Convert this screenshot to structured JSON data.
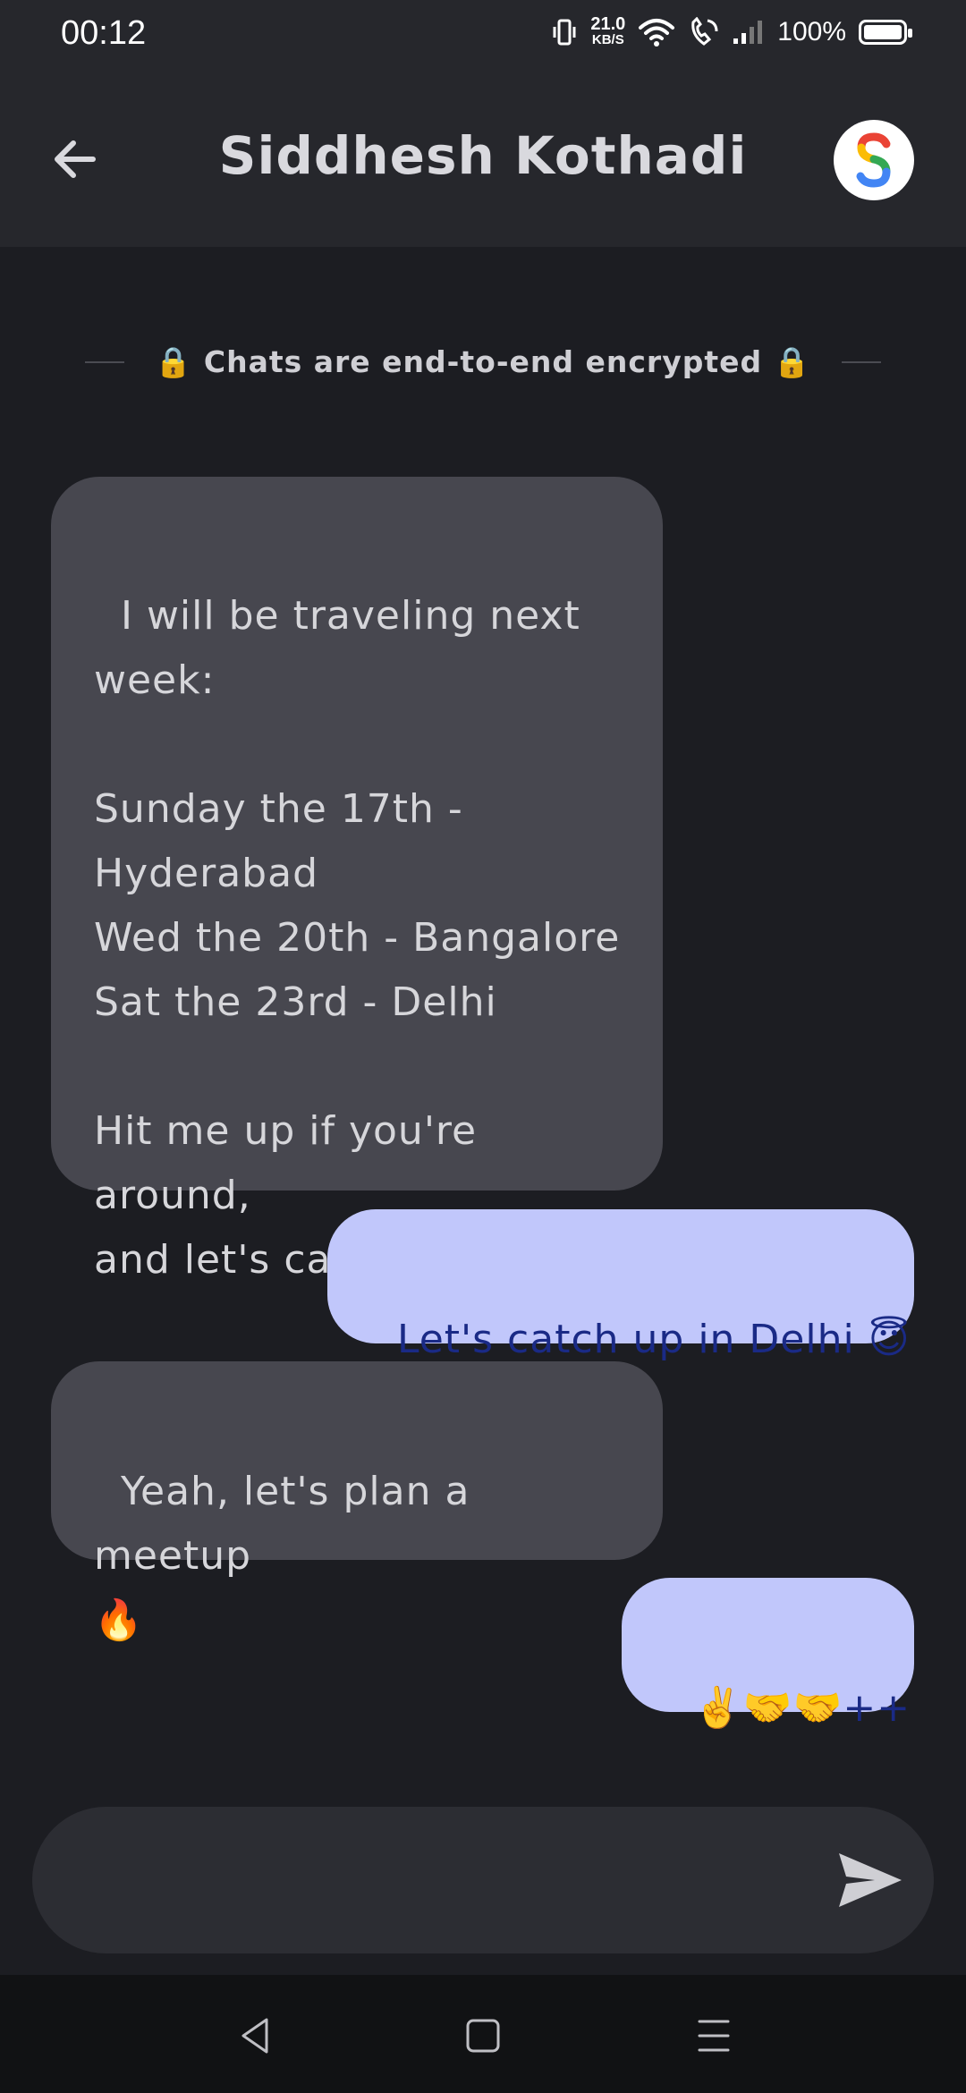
{
  "status_bar": {
    "time": "00:12",
    "net_speed_value": "21.0",
    "net_speed_unit": "KB/S",
    "battery": "100%"
  },
  "header": {
    "title": "Siddhesh Kothadi",
    "avatar_letter": "S"
  },
  "encryption_notice": "🔒 Chats are end-to-end encrypted 🔒",
  "messages": [
    {
      "from": "them",
      "text": "I will be traveling next\nweek:\n\nSunday the 17th -\nHyderabad\nWed the 20th - Bangalore\nSat the 23rd - Delhi\n\nHit me up if you're around,\nand let's catch up! 🚀"
    },
    {
      "from": "me",
      "text": "Let's catch up in Delhi 😇"
    },
    {
      "from": "them",
      "text": "Yeah, let's plan a meetup\n🔥"
    },
    {
      "from": "me",
      "text": "✌️🤝🤝++"
    }
  ],
  "composer": {
    "value": "",
    "placeholder": ""
  },
  "colors": {
    "background": "#1c1d22",
    "bar": "#26272c",
    "incoming_bubble": "#47474f",
    "outgoing_bubble": "#c1c7fb",
    "outgoing_text": "#1a2a86"
  }
}
